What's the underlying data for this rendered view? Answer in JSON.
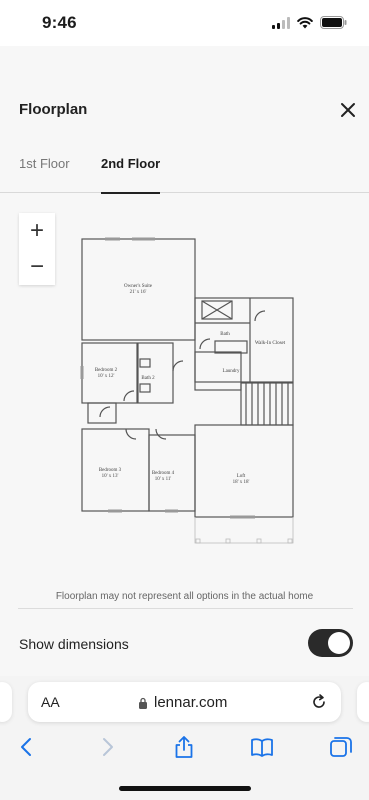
{
  "status": {
    "time": "9:46"
  },
  "header": {
    "title": "Floorplan",
    "close_icon": "close-icon"
  },
  "tabs": [
    {
      "label": "1st Floor",
      "active": false
    },
    {
      "label": "2nd Floor",
      "active": true
    }
  ],
  "zoom": {
    "in": "+",
    "out": "−"
  },
  "floorplan": {
    "rooms": {
      "owners_suite": {
        "name": "Owner's Suite",
        "dims": "21' x 16'"
      },
      "bath": {
        "name": "Bath"
      },
      "walk_in_closet": {
        "name": "Walk-In Closet"
      },
      "bedroom2": {
        "name": "Bedroom 2",
        "dims": "10' x 12'"
      },
      "bath2": {
        "name": "Bath 2"
      },
      "laundry": {
        "name": "Laundry"
      },
      "bedroom3": {
        "name": "Bedroom 3",
        "dims": "10' x 13'"
      },
      "bedroom4": {
        "name": "Bedroom 4",
        "dims": "10' x 11'"
      },
      "loft": {
        "name": "Loft",
        "dims": "18' x 18'"
      }
    }
  },
  "footer": {
    "disclaimer": "Floorplan may not represent all options in the actual home",
    "show_dimensions_label": "Show dimensions",
    "show_dimensions_on": true
  },
  "browser": {
    "aa_label": "AA",
    "url": "lennar.com"
  },
  "colors": {
    "toggle_on": "#2a2a2a",
    "link_blue": "#1a73e8"
  }
}
